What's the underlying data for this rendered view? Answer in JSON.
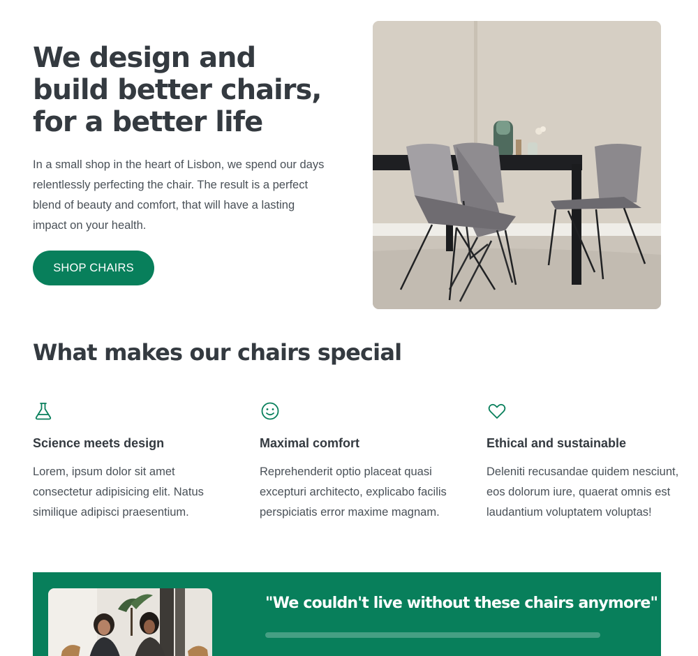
{
  "hero": {
    "title": "We design and build better chairs, for a better life",
    "text": "In a small shop in the heart of Lisbon, we spend our days relentlessly perfecting the chair. The result is a perfect blend of beauty and comfort, that will have a lasting impact on your health.",
    "cta_label": "SHOP CHAIRS"
  },
  "features": {
    "title": "What makes our chairs special",
    "items": [
      {
        "icon": "flask-icon",
        "title": "Science meets design",
        "text": "Lorem, ipsum dolor sit amet consectetur adipisicing elit. Natus similique adipisci praesentium."
      },
      {
        "icon": "smiley-icon",
        "title": "Maximal comfort",
        "text": "Reprehenderit optio placeat quasi excepturi architecto, explicabo facilis perspiciatis error maxime magnam."
      },
      {
        "icon": "heart-icon",
        "title": "Ethical and sustainable",
        "text": "Deleniti recusandae quidem nesciunt, eos dolorum iure, quaerat omnis est laudantium voluptatem voluptas!"
      }
    ]
  },
  "testimonial": {
    "quote": "\"We couldn't live without these chairs anymore\""
  },
  "colors": {
    "accent": "#087f5b",
    "text": "#343a40",
    "body_text": "#495057",
    "background": "#ffffff"
  }
}
